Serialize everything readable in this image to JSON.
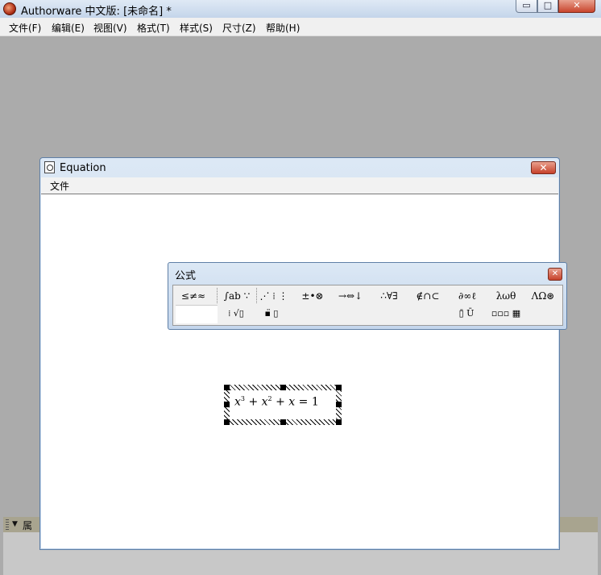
{
  "window": {
    "title": "Authorware 中文版: [未命名] *",
    "buttons": {
      "minimize": "▭",
      "maximize": "□",
      "close": "✕"
    }
  },
  "menubar": {
    "items": [
      "文件(F)",
      "编辑(E)",
      "视图(V)",
      "格式(T)",
      "样式(S)",
      "尺寸(Z)",
      "帮助(H)"
    ]
  },
  "properties_strip": {
    "label": "属"
  },
  "equation_window": {
    "title": "Equation",
    "close": "✕",
    "menu": {
      "file": "文件"
    }
  },
  "palette": {
    "title": "公式",
    "close": "✕",
    "row1": [
      "≤≠≈",
      "∫ab ∵",
      "⋰ ⁞ ⋮",
      "±•⊗",
      "→⇔↓",
      "∴∀∃",
      "∉∩⊂",
      "∂∞ℓ",
      "λωθ",
      "ΛΩ⊛"
    ],
    "row2": [
      "⁞ √▯",
      "▪̈ ▯",
      "▯̄ Ū",
      "▫▫▫ ▦"
    ]
  },
  "equation": {
    "base1": "x",
    "exp1": "3",
    "op1": " + ",
    "base2": "x",
    "exp2": "2",
    "op2": " + ",
    "term3": "x",
    "eq": " = ",
    "rhs": "1"
  },
  "colors": {
    "workspace": "#ababab",
    "close_button": "#c6412a",
    "title_gradient": "#dce8f5"
  }
}
